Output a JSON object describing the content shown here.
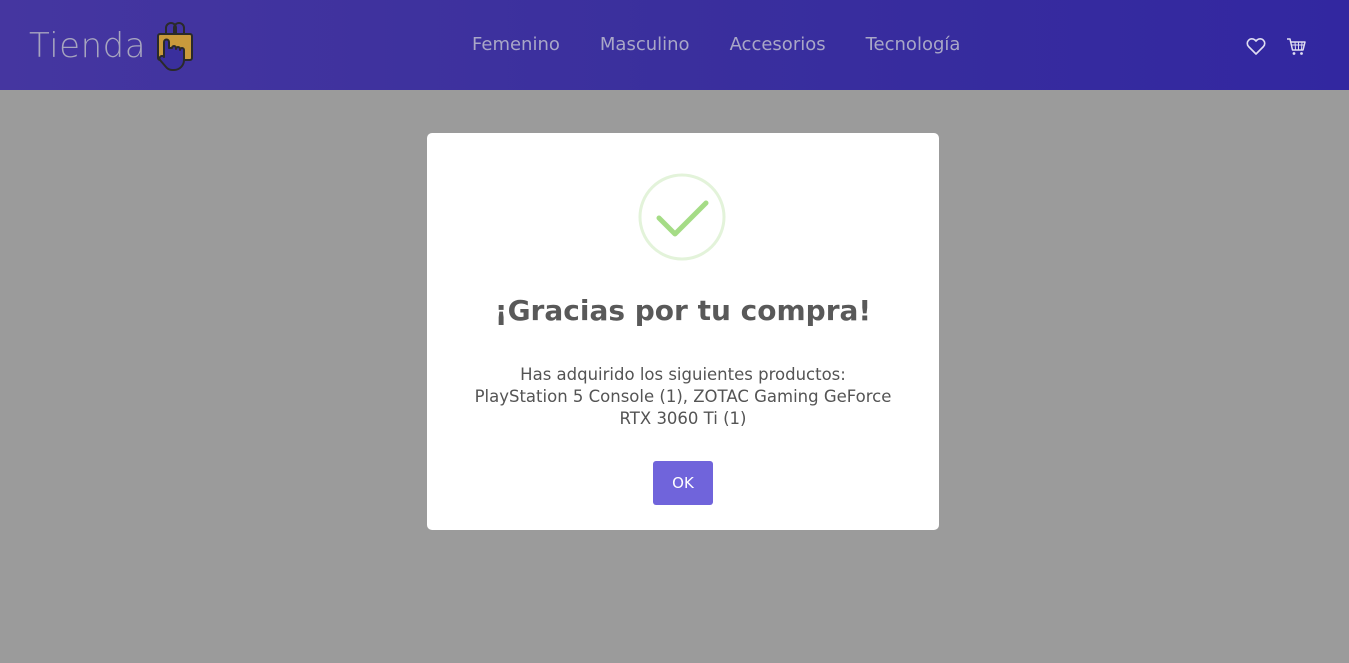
{
  "navbar": {
    "brand": "Tienda",
    "links": [
      {
        "label": "Femenino"
      },
      {
        "label": "Masculino"
      },
      {
        "label": "Accesorios"
      },
      {
        "label": "Tecnología"
      }
    ],
    "icons": [
      "heart-icon",
      "cart-icon"
    ]
  },
  "modal": {
    "icon": "success-check-icon",
    "title": "¡Gracias por tu compra!",
    "body_line1": "Has adquirido los siguientes productos:",
    "body_line2": "PlayStation 5 Console (1), ZOTAC Gaming GeForce RTX 3060 Ti (1)",
    "ok_label": "OK"
  },
  "colors": {
    "navbar": "#3a2f9d",
    "overlay": "#9b9b9b",
    "ok_button": "#7064db",
    "success_green": "#a5dc86"
  }
}
